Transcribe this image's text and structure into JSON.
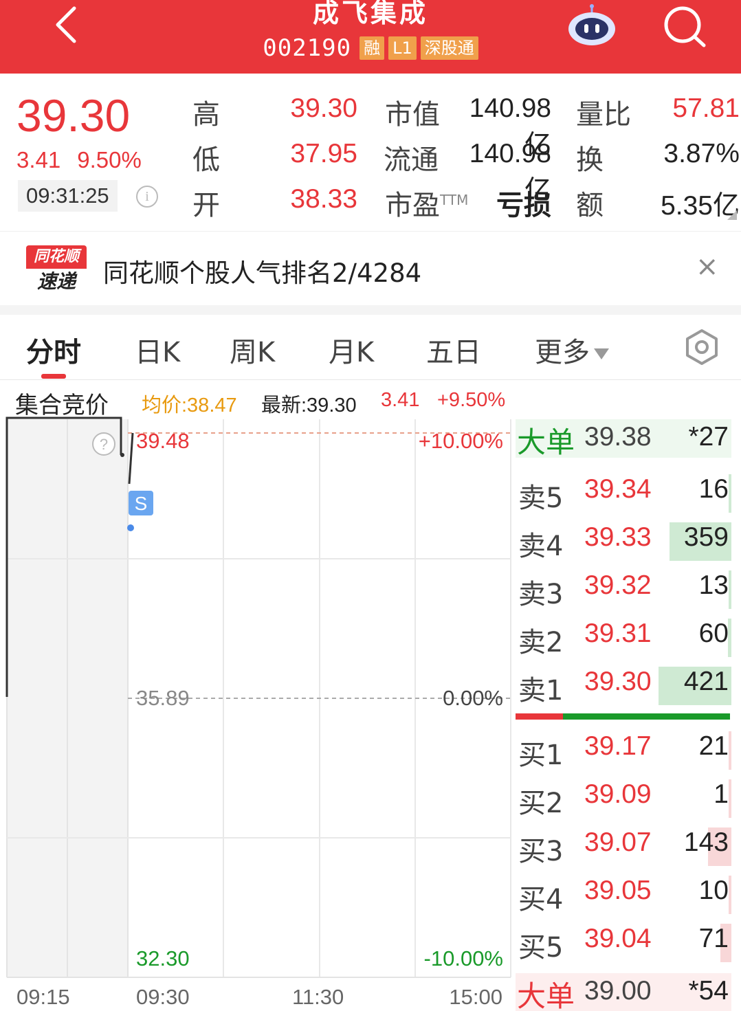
{
  "header": {
    "title": "成飞集成",
    "code": "002190",
    "tags": [
      "融",
      "L1",
      "深股通"
    ]
  },
  "quote": {
    "price": "39.30",
    "change": "3.41",
    "change_pct": "9.50%",
    "time": "09:31:25",
    "info_icon": "i",
    "stats": [
      {
        "label": "高",
        "value": "39.30"
      },
      {
        "label": "低",
        "value": "37.95"
      },
      {
        "label": "开",
        "value": "38.33"
      }
    ],
    "stats2": [
      {
        "label": "市值",
        "value": "140.98亿"
      },
      {
        "label": "流通",
        "value": "140.98亿"
      },
      {
        "label": "市盈",
        "sup": "TTM",
        "value": "亏损"
      }
    ],
    "stats3": [
      {
        "label": "量比",
        "value": "57.81"
      },
      {
        "label": "换",
        "value": "3.87%"
      },
      {
        "label": "额",
        "value": "5.35亿"
      }
    ]
  },
  "banner": {
    "logo_top": "同花顺",
    "logo_bottom": "速递",
    "text": "同花顺个股人气排名2/4284",
    "close": "×"
  },
  "tabs": [
    "分时",
    "日K",
    "周K",
    "月K",
    "五日",
    "更多"
  ],
  "chart_header": {
    "label": "集合竞价",
    "avg": "均价:38.47",
    "latest": "最新:39.30",
    "change": "3.41",
    "change_pct": "+9.50%"
  },
  "chart_data": {
    "type": "line",
    "y_labels": {
      "top": "39.48",
      "mid": "35.89",
      "bottom": "32.30"
    },
    "pct_labels": {
      "top": "+10.00%",
      "mid": "0.00%",
      "bottom": "-10.00%"
    },
    "x_labels": [
      "09:15",
      "09:30",
      "11:30",
      "15:00"
    ],
    "ylim": [
      32.3,
      39.48
    ],
    "auction_price": 39.3,
    "marker": "S",
    "help_icon": "?"
  },
  "order_book": {
    "big_sell": {
      "label": "大单",
      "price": "39.38",
      "vol": "*27"
    },
    "sells": [
      {
        "label": "卖5",
        "price": "39.34",
        "vol": "16",
        "bar": 0.02
      },
      {
        "label": "卖4",
        "price": "39.33",
        "vol": "359",
        "bar": 0.85
      },
      {
        "label": "卖3",
        "price": "39.32",
        "vol": "13",
        "bar": 0.02
      },
      {
        "label": "卖2",
        "price": "39.31",
        "vol": "60",
        "bar": 0.05
      },
      {
        "label": "卖1",
        "price": "39.30",
        "vol": "421",
        "bar": 1.0
      }
    ],
    "buys": [
      {
        "label": "买1",
        "price": "39.17",
        "vol": "21",
        "bar": 0.02
      },
      {
        "label": "买2",
        "price": "39.09",
        "vol": "1",
        "bar": 0.0
      },
      {
        "label": "买3",
        "price": "39.07",
        "vol": "143",
        "bar": 0.32
      },
      {
        "label": "买4",
        "price": "39.05",
        "vol": "10",
        "bar": 0.02
      },
      {
        "label": "买5",
        "price": "39.04",
        "vol": "71",
        "bar": 0.15
      }
    ],
    "big_buy": {
      "label": "大单",
      "price": "39.00",
      "vol": "*54"
    },
    "split_ratio": 0.22
  },
  "colors": {
    "brand_red": "#e8363a",
    "up": "#e8363a",
    "down": "#1a9a2a",
    "avg": "#e89a10",
    "sell_bar": "#cfead3",
    "buy_bar": "#f8d7d8"
  }
}
